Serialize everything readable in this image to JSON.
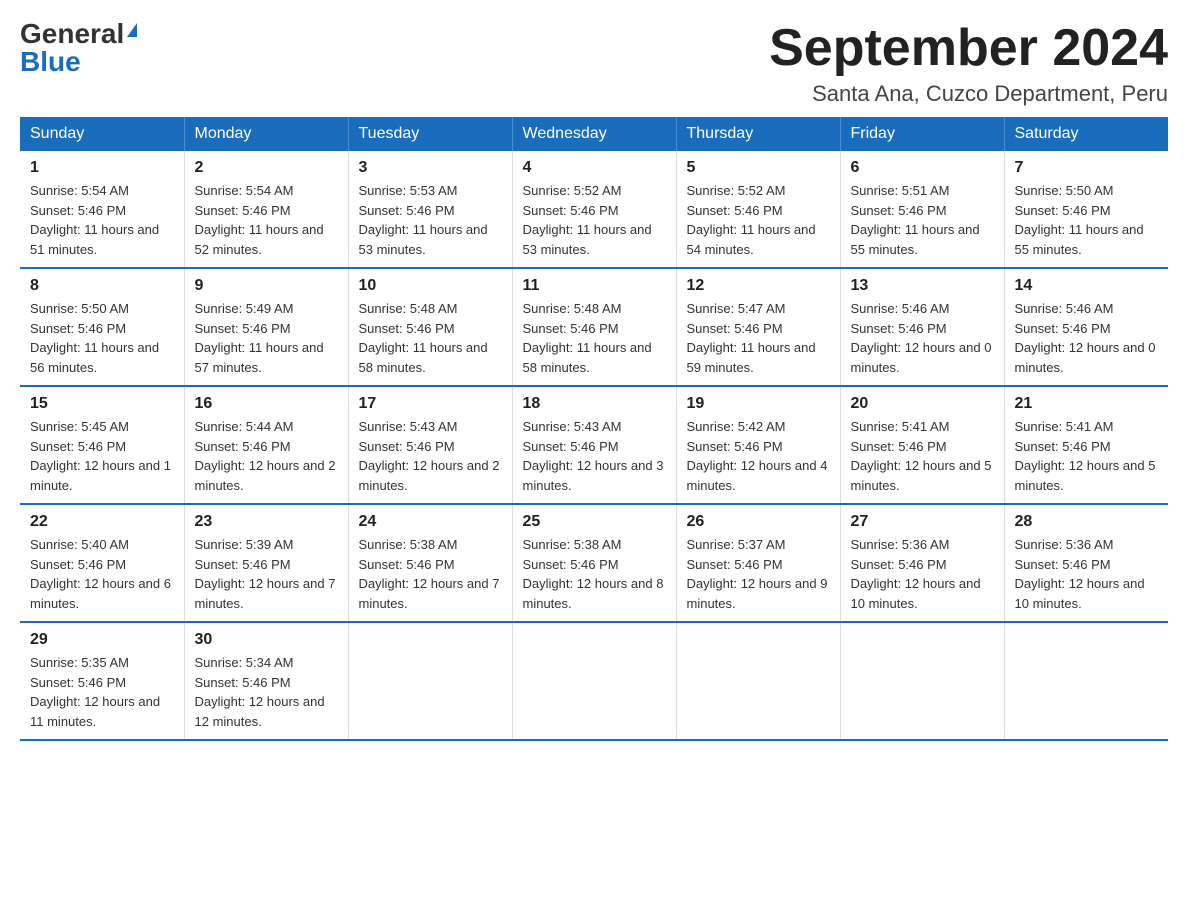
{
  "header": {
    "logo_general": "General",
    "logo_blue": "Blue",
    "month_title": "September 2024",
    "location": "Santa Ana, Cuzco Department, Peru"
  },
  "days_of_week": [
    "Sunday",
    "Monday",
    "Tuesday",
    "Wednesday",
    "Thursday",
    "Friday",
    "Saturday"
  ],
  "weeks": [
    [
      {
        "day": "1",
        "sunrise": "5:54 AM",
        "sunset": "5:46 PM",
        "daylight": "11 hours and 51 minutes."
      },
      {
        "day": "2",
        "sunrise": "5:54 AM",
        "sunset": "5:46 PM",
        "daylight": "11 hours and 52 minutes."
      },
      {
        "day": "3",
        "sunrise": "5:53 AM",
        "sunset": "5:46 PM",
        "daylight": "11 hours and 53 minutes."
      },
      {
        "day": "4",
        "sunrise": "5:52 AM",
        "sunset": "5:46 PM",
        "daylight": "11 hours and 53 minutes."
      },
      {
        "day": "5",
        "sunrise": "5:52 AM",
        "sunset": "5:46 PM",
        "daylight": "11 hours and 54 minutes."
      },
      {
        "day": "6",
        "sunrise": "5:51 AM",
        "sunset": "5:46 PM",
        "daylight": "11 hours and 55 minutes."
      },
      {
        "day": "7",
        "sunrise": "5:50 AM",
        "sunset": "5:46 PM",
        "daylight": "11 hours and 55 minutes."
      }
    ],
    [
      {
        "day": "8",
        "sunrise": "5:50 AM",
        "sunset": "5:46 PM",
        "daylight": "11 hours and 56 minutes."
      },
      {
        "day": "9",
        "sunrise": "5:49 AM",
        "sunset": "5:46 PM",
        "daylight": "11 hours and 57 minutes."
      },
      {
        "day": "10",
        "sunrise": "5:48 AM",
        "sunset": "5:46 PM",
        "daylight": "11 hours and 58 minutes."
      },
      {
        "day": "11",
        "sunrise": "5:48 AM",
        "sunset": "5:46 PM",
        "daylight": "11 hours and 58 minutes."
      },
      {
        "day": "12",
        "sunrise": "5:47 AM",
        "sunset": "5:46 PM",
        "daylight": "11 hours and 59 minutes."
      },
      {
        "day": "13",
        "sunrise": "5:46 AM",
        "sunset": "5:46 PM",
        "daylight": "12 hours and 0 minutes."
      },
      {
        "day": "14",
        "sunrise": "5:46 AM",
        "sunset": "5:46 PM",
        "daylight": "12 hours and 0 minutes."
      }
    ],
    [
      {
        "day": "15",
        "sunrise": "5:45 AM",
        "sunset": "5:46 PM",
        "daylight": "12 hours and 1 minute."
      },
      {
        "day": "16",
        "sunrise": "5:44 AM",
        "sunset": "5:46 PM",
        "daylight": "12 hours and 2 minutes."
      },
      {
        "day": "17",
        "sunrise": "5:43 AM",
        "sunset": "5:46 PM",
        "daylight": "12 hours and 2 minutes."
      },
      {
        "day": "18",
        "sunrise": "5:43 AM",
        "sunset": "5:46 PM",
        "daylight": "12 hours and 3 minutes."
      },
      {
        "day": "19",
        "sunrise": "5:42 AM",
        "sunset": "5:46 PM",
        "daylight": "12 hours and 4 minutes."
      },
      {
        "day": "20",
        "sunrise": "5:41 AM",
        "sunset": "5:46 PM",
        "daylight": "12 hours and 5 minutes."
      },
      {
        "day": "21",
        "sunrise": "5:41 AM",
        "sunset": "5:46 PM",
        "daylight": "12 hours and 5 minutes."
      }
    ],
    [
      {
        "day": "22",
        "sunrise": "5:40 AM",
        "sunset": "5:46 PM",
        "daylight": "12 hours and 6 minutes."
      },
      {
        "day": "23",
        "sunrise": "5:39 AM",
        "sunset": "5:46 PM",
        "daylight": "12 hours and 7 minutes."
      },
      {
        "day": "24",
        "sunrise": "5:38 AM",
        "sunset": "5:46 PM",
        "daylight": "12 hours and 7 minutes."
      },
      {
        "day": "25",
        "sunrise": "5:38 AM",
        "sunset": "5:46 PM",
        "daylight": "12 hours and 8 minutes."
      },
      {
        "day": "26",
        "sunrise": "5:37 AM",
        "sunset": "5:46 PM",
        "daylight": "12 hours and 9 minutes."
      },
      {
        "day": "27",
        "sunrise": "5:36 AM",
        "sunset": "5:46 PM",
        "daylight": "12 hours and 10 minutes."
      },
      {
        "day": "28",
        "sunrise": "5:36 AM",
        "sunset": "5:46 PM",
        "daylight": "12 hours and 10 minutes."
      }
    ],
    [
      {
        "day": "29",
        "sunrise": "5:35 AM",
        "sunset": "5:46 PM",
        "daylight": "12 hours and 11 minutes."
      },
      {
        "day": "30",
        "sunrise": "5:34 AM",
        "sunset": "5:46 PM",
        "daylight": "12 hours and 12 minutes."
      },
      null,
      null,
      null,
      null,
      null
    ]
  ]
}
